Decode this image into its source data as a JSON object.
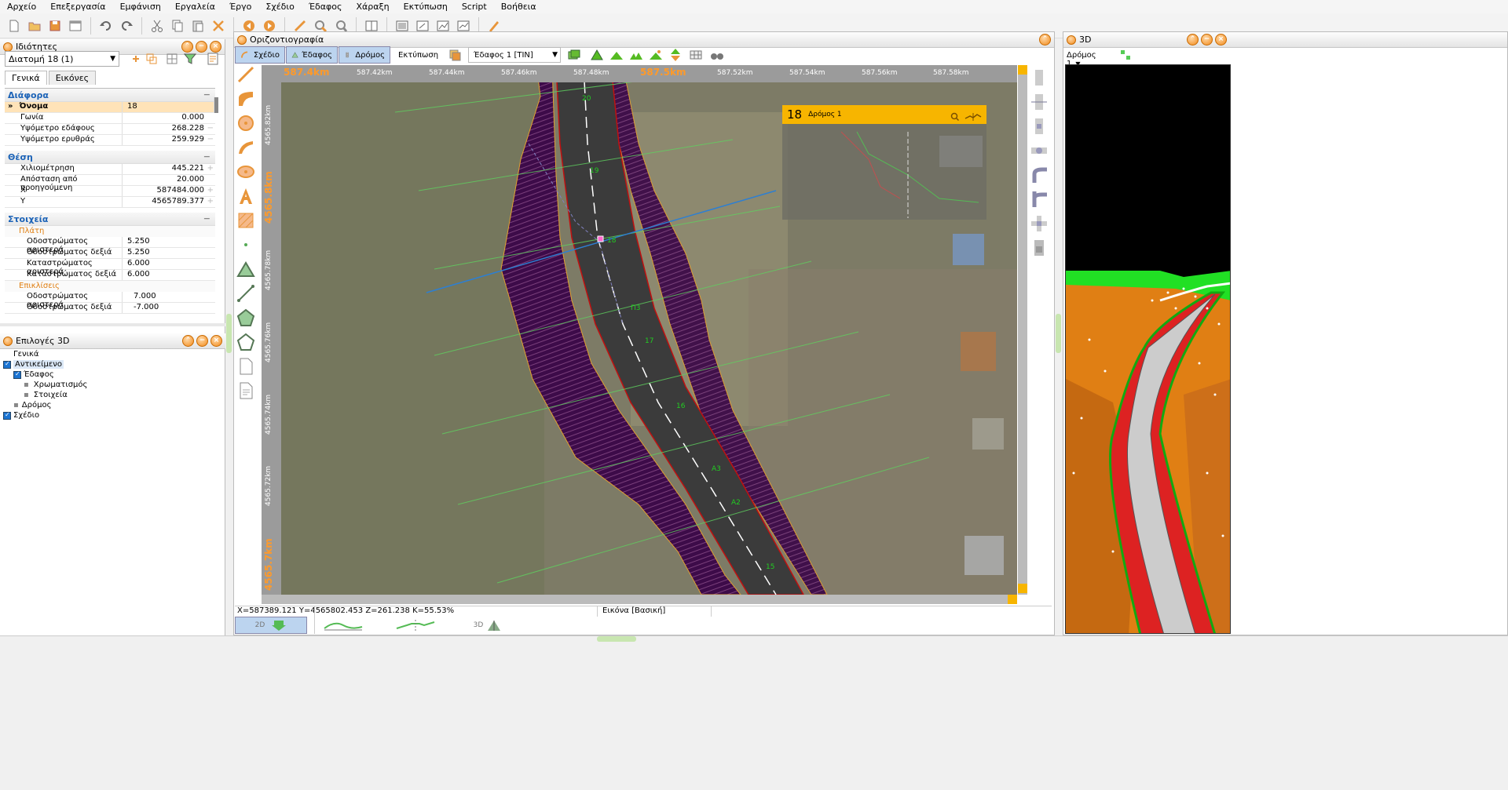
{
  "menu": [
    "Αρχείο",
    "Επεξεργασία",
    "Εμφάνιση",
    "Εργαλεία",
    "Έργο",
    "Σχέδιο",
    "Έδαφος",
    "Χάραξη",
    "Εκτύπωση",
    "Script",
    "Βοήθεια"
  ],
  "properties": {
    "title": "Ιδιότητες",
    "selector": "Διατομή 18 (1)",
    "tabs": [
      "Γενικά",
      "Εικόνες"
    ],
    "sections": {
      "misc": {
        "title": "Διάφορα",
        "rows": [
          {
            "k": "Όνομα",
            "v": "18"
          },
          {
            "k": "Γωνία",
            "v": "0.000"
          },
          {
            "k": "Υψόμετρο εδάφους",
            "v": "268.228"
          },
          {
            "k": "Υψόμετρο ερυθράς",
            "v": "259.929"
          }
        ]
      },
      "position": {
        "title": "Θέση",
        "rows": [
          {
            "k": "Χιλιομέτρηση",
            "v": "445.221"
          },
          {
            "k": "Απόσταση από προηγούμενη",
            "v": "20.000"
          },
          {
            "k": "X",
            "v": "587484.000"
          },
          {
            "k": "Y",
            "v": "4565789.377"
          }
        ]
      },
      "elements": {
        "title": "Στοιχεία",
        "widths_title": "Πλάτη",
        "widths": [
          {
            "k": "Οδοστρώματος αριστερά",
            "v": "5.250"
          },
          {
            "k": "Οδοστρώματος δεξιά",
            "v": "5.250"
          },
          {
            "k": "Καταστρώματος αριστερά",
            "v": "6.000"
          },
          {
            "k": "Καταστρώματος δεξιά",
            "v": "6.000"
          }
        ],
        "slopes_title": "Επικλίσεις",
        "slopes": [
          {
            "k": "Οδοστρώματος αριστερά",
            "v": "7.000"
          },
          {
            "k": "Οδοστρώματος δεξιά",
            "v": "-7.000"
          }
        ]
      }
    }
  },
  "options3d": {
    "title": "Επιλογές 3D",
    "tree": [
      "Γενικά",
      "Αντικείμενο",
      "Έδαφος",
      "Χρωματισμός",
      "Στοιχεία",
      "Δρόμος",
      "Σχέδιο"
    ]
  },
  "plan": {
    "title": "Οριζοντιογραφία",
    "tabs": [
      "Σχέδιο",
      "Έδαφος",
      "Δρόμος",
      "Εκτύπωση"
    ],
    "terrain_select": "Έδαφος 1 [TIN]",
    "ruler_h": [
      "587.4km",
      "587.42km",
      "587.44km",
      "587.46km",
      "587.48km",
      "587.5km",
      "587.52km",
      "587.54km",
      "587.56km",
      "587.58km"
    ],
    "ruler_v": [
      "4565.82km",
      "4565.8km",
      "4565.78km",
      "4565.76km",
      "4565.74km",
      "4565.72km",
      "4565.7km"
    ],
    "stations": [
      "20",
      "19",
      "18",
      "П3",
      "17",
      "16",
      "A3",
      "A2",
      "15"
    ],
    "overview": {
      "num": "18",
      "name": "Δρόμος 1"
    },
    "status": {
      "coords": "X=587389.121  Y=4565802.453  Z=261.238  K=55.53%",
      "layer": "Εικόνα [Βασική]"
    },
    "bottom_tabs": [
      "2D",
      "",
      "",
      "3D"
    ]
  },
  "view3d": {
    "title": "3D",
    "road_select": "Δρόμος 1"
  }
}
